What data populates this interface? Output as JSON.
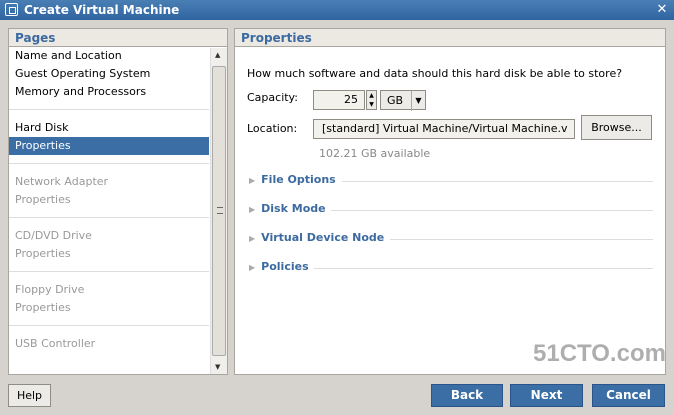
{
  "window": {
    "title": "Create Virtual Machine",
    "close_icon": "close-icon"
  },
  "pages": {
    "header": "Pages",
    "groups": [
      [
        {
          "label": "Name and Location",
          "state": "normal"
        },
        {
          "label": "Guest Operating System",
          "state": "normal"
        },
        {
          "label": "Memory and Processors",
          "state": "normal"
        }
      ],
      [
        {
          "label": "Hard Disk",
          "state": "normal"
        },
        {
          "label": "Properties",
          "state": "selected"
        }
      ],
      [
        {
          "label": "Network Adapter",
          "state": "disabled"
        },
        {
          "label": "Properties",
          "state": "disabled"
        }
      ],
      [
        {
          "label": "CD/DVD Drive",
          "state": "disabled"
        },
        {
          "label": "Properties",
          "state": "disabled"
        }
      ],
      [
        {
          "label": "Floppy Drive",
          "state": "disabled"
        },
        {
          "label": "Properties",
          "state": "disabled"
        }
      ],
      [
        {
          "label": "USB Controller",
          "state": "disabled"
        }
      ]
    ]
  },
  "properties": {
    "header": "Properties",
    "question": "How much software and data should this hard disk be able to store?",
    "capacity_label": "Capacity:",
    "capacity_value": "25",
    "capacity_unit": "GB",
    "location_label": "Location:",
    "location_value": "[standard] Virtual Machine/Virtual Machine.v",
    "browse_label": "Browse...",
    "available": "102.21 GB available",
    "sections": [
      "File Options",
      "Disk Mode",
      "Virtual Device Node",
      "Policies"
    ]
  },
  "buttons": {
    "help": "Help",
    "back": "Back",
    "next": "Next",
    "cancel": "Cancel"
  },
  "watermark": "51CTO.com",
  "colors": {
    "accent": "#3a6ea5",
    "header_text": "#3c6aa0"
  }
}
